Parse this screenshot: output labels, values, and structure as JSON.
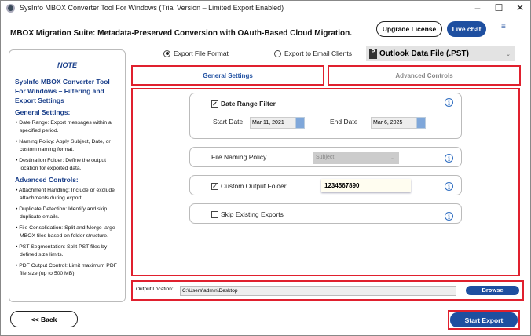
{
  "window": {
    "title": "SysInfo MBOX Converter Tool For Windows (Trial Version – Limited Export Enabled)",
    "minimize": "–",
    "maximize": "☐",
    "close": "✕"
  },
  "header": {
    "heading": "MBOX Migration Suite: Metadata-Preserved Conversion with OAuth-Based Cloud Migration.",
    "upgrade": "Upgrade License",
    "live_chat": "Live chat",
    "menu": "≡"
  },
  "note": {
    "title": "NOTE",
    "subtitle": "SysInfo MBOX Converter Tool For Windows – Filtering and Export Settings",
    "general_heading": "General Settings:",
    "general": [
      "• Date Range: Export messages within a specified period.",
      "• Naming Policy: Apply Subject, Date, or custom naming format.",
      "• Destination Folder: Define the output location for exported data."
    ],
    "advanced_heading": "Advanced Controls:",
    "advanced": [
      "• Attachment Handling: Include or exclude attachments during export.",
      "• Duplicate Detection: Identify and skip duplicate emails.",
      "• File Consolidation: Split and Merge large MBOX files based on folder structure.",
      "• PST Segmentation: Split PST files by defined size limits.",
      "• PDF Output Control: Limit maximum PDF file size (up to 500 MB)."
    ]
  },
  "export": {
    "option1": "Export File Format",
    "option2": "Export to Email Clients",
    "selected": "option1",
    "format": "Outlook Data File (.PST)",
    "format_icon": "P"
  },
  "tabs": [
    {
      "label": "General Settings",
      "active": true
    },
    {
      "label": "Advanced Controls",
      "active": false
    }
  ],
  "settings": {
    "date_filter": {
      "label": "Date Range Filter",
      "checked": true,
      "start_label": "Start Date",
      "start": "Mar 11, 2021",
      "end_label": "End Date",
      "end": "Mar 6, 2025"
    },
    "naming": {
      "label": "File Naming Policy",
      "value": "Subject"
    },
    "custom_folder": {
      "label": "Custom Output Folder",
      "checked": true,
      "value": "1234567890"
    },
    "skip": {
      "label": "Skip Existing Exports",
      "checked": false
    }
  },
  "output": {
    "label": "Output Location:",
    "path": "C:\\Users\\admin\\Desktop",
    "browse": "Browse"
  },
  "footer": {
    "back": "<< Back",
    "start": "Start Export"
  },
  "colors": {
    "accent": "#1e4fa0",
    "highlight": "#e0202e",
    "note_text": "#1a3f8a"
  }
}
